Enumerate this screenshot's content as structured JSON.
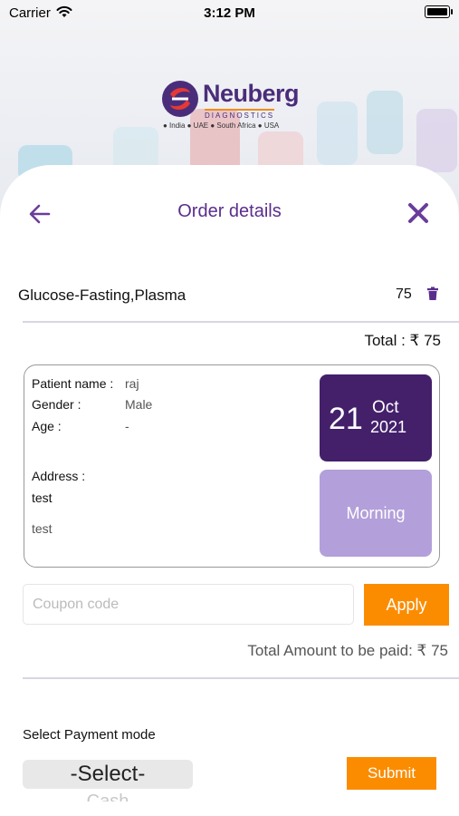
{
  "status_bar": {
    "carrier": "Carrier",
    "time": "3:12 PM"
  },
  "brand": {
    "name": "Neuberg",
    "subtitle": "DIAGNOSTICS",
    "countries": "● India ● UAE ● South Africa ● USA"
  },
  "header": {
    "title": "Order details"
  },
  "order_item": {
    "name": "Glucose-Fasting,Plasma",
    "price": "75"
  },
  "total": "Total : ₹ 75",
  "patient": {
    "name_label": "Patient name :",
    "name_value": "raj",
    "gender_label": "Gender :",
    "gender_value": "Male",
    "age_label": "Age :",
    "age_value": "-",
    "address_label": "Address :",
    "address_line1": "test",
    "address_line2": "test"
  },
  "appointment": {
    "day": "21",
    "month": "Oct",
    "year": "2021",
    "slot": "Morning"
  },
  "coupon": {
    "placeholder": "Coupon code",
    "value": "",
    "apply_label": "Apply"
  },
  "amount_due": "Total Amount to be paid: ₹ 75",
  "payment": {
    "label": "Select Payment mode",
    "selected": "-Select-",
    "next_option": "Cash",
    "submit_label": "Submit"
  },
  "colors": {
    "brand_purple": "#5a2d8c",
    "date_bg": "#44206b",
    "slot_bg": "#b39fda",
    "accent_orange": "#fb8c00"
  }
}
